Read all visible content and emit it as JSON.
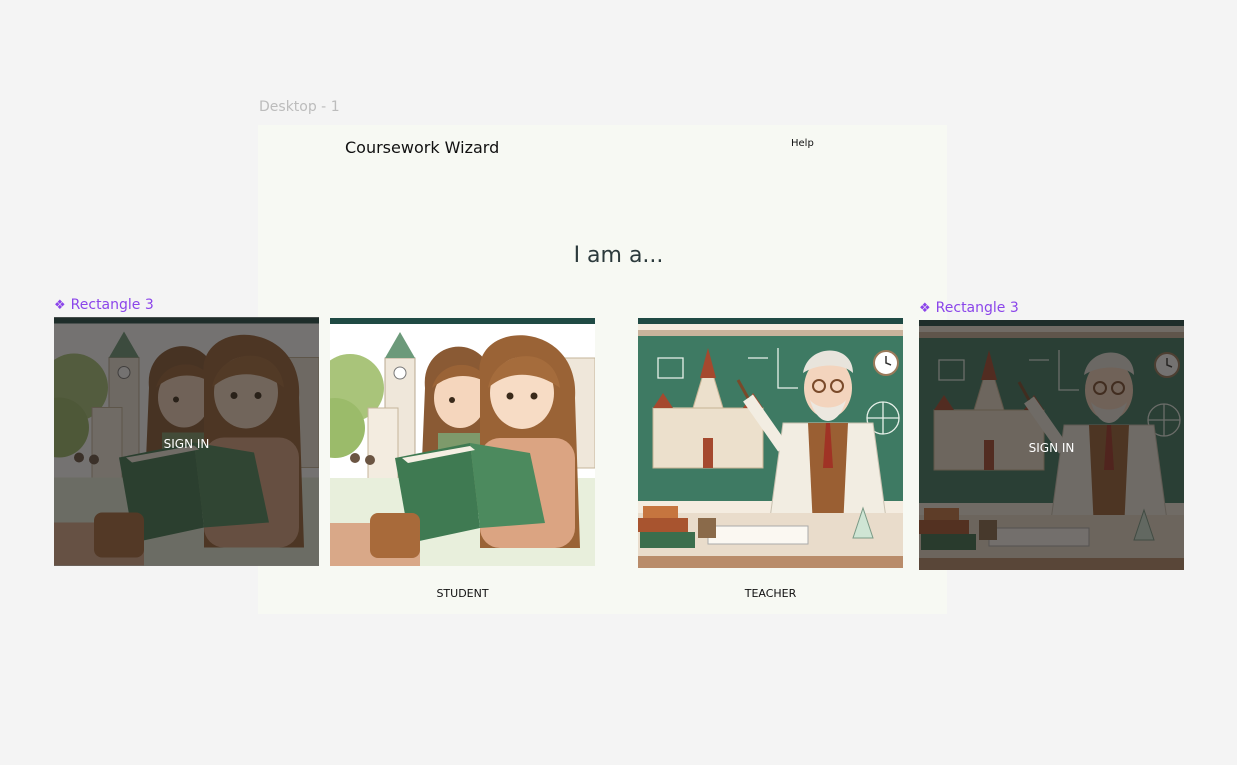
{
  "frame": {
    "label": "Desktop - 1"
  },
  "header": {
    "app_title": "Coursework Wizard",
    "help_label": "Help"
  },
  "main": {
    "heading": "I am a...",
    "options": [
      {
        "caption": "STUDENT"
      },
      {
        "caption": "TEACHER"
      }
    ]
  },
  "components": [
    {
      "label": "Rectangle 3",
      "action_label": "SIGN IN"
    },
    {
      "label": "Rectangle 3",
      "action_label": "SIGN IN"
    }
  ],
  "colors": {
    "canvas_bg": "#f4f4f4",
    "frame_bg": "#f7f9f3",
    "component_accent": "#8b45ea",
    "card_top_bar": "#1f4a44",
    "chalkboard": "#3e7a63"
  }
}
